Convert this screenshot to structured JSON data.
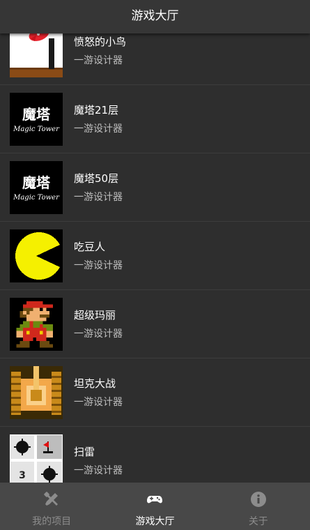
{
  "header": {
    "title": "游戏大厅"
  },
  "games": [
    {
      "title": "愤怒的小鸟",
      "subtitle": "一游设计器",
      "icon": "angry-birds-icon"
    },
    {
      "title": "魔塔21层",
      "subtitle": "一游设计器",
      "icon": "magic-tower-icon",
      "thumb_text": "魔塔",
      "thumb_script": "Magic Tower"
    },
    {
      "title": "魔塔50层",
      "subtitle": "一游设计器",
      "icon": "magic-tower-icon",
      "thumb_text": "魔塔",
      "thumb_script": "Magic Tower"
    },
    {
      "title": "吃豆人",
      "subtitle": "一游设计器",
      "icon": "pacman-icon"
    },
    {
      "title": "超级玛丽",
      "subtitle": "一游设计器",
      "icon": "mario-icon"
    },
    {
      "title": "坦克大战",
      "subtitle": "一游设计器",
      "icon": "tank-icon"
    },
    {
      "title": "扫雷",
      "subtitle": "一游设计器",
      "icon": "minesweeper-icon",
      "thumb_number": "3"
    }
  ],
  "tabbar": {
    "tabs": [
      {
        "label": "我的项目",
        "icon": "tools-icon",
        "active": false
      },
      {
        "label": "游戏大厅",
        "icon": "gamepad-icon",
        "active": true
      },
      {
        "label": "关于",
        "icon": "info-icon",
        "active": false
      }
    ]
  },
  "colors": {
    "background": "#2e2e2e",
    "header": "#363636",
    "tabbar": "#484848",
    "text_primary": "#ffffff",
    "text_secondary": "#bdbdbd",
    "tab_inactive": "#8c8c8c"
  }
}
